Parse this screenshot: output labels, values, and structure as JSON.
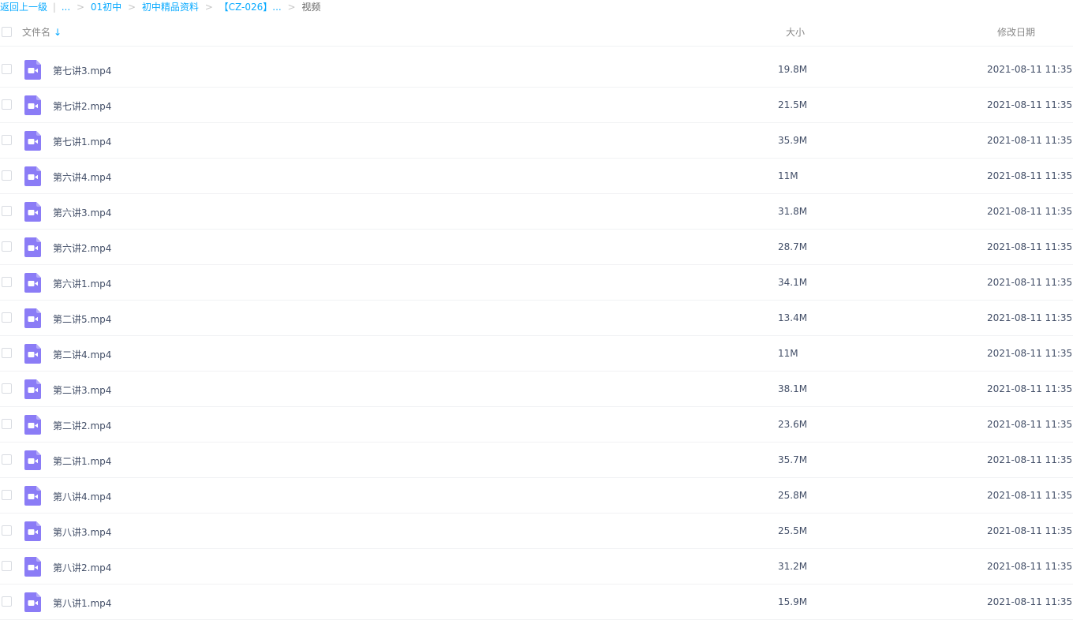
{
  "breadcrumb": {
    "back": "返回上一级",
    "divider": "|",
    "ellipsis1": "...",
    "crumb1": "01初中",
    "crumb2": "初中精品资料",
    "crumb3": "【CZ-026】...",
    "current": "视频",
    "sep": ">"
  },
  "header": {
    "name": "文件名",
    "sort_icon": "arrow-down-icon",
    "size": "大小",
    "date": "修改日期"
  },
  "accent_color": "#09aaff",
  "icon_color": "#8b7cf6",
  "files": [
    {
      "name": "第七讲3.mp4",
      "size": "19.8M",
      "date": "2021-08-11 11:35"
    },
    {
      "name": "第七讲2.mp4",
      "size": "21.5M",
      "date": "2021-08-11 11:35"
    },
    {
      "name": "第七讲1.mp4",
      "size": "35.9M",
      "date": "2021-08-11 11:35"
    },
    {
      "name": "第六讲4.mp4",
      "size": "11M",
      "date": "2021-08-11 11:35"
    },
    {
      "name": "第六讲3.mp4",
      "size": "31.8M",
      "date": "2021-08-11 11:35"
    },
    {
      "name": "第六讲2.mp4",
      "size": "28.7M",
      "date": "2021-08-11 11:35"
    },
    {
      "name": "第六讲1.mp4",
      "size": "34.1M",
      "date": "2021-08-11 11:35"
    },
    {
      "name": "第二讲5.mp4",
      "size": "13.4M",
      "date": "2021-08-11 11:35"
    },
    {
      "name": "第二讲4.mp4",
      "size": "11M",
      "date": "2021-08-11 11:35"
    },
    {
      "name": "第二讲3.mp4",
      "size": "38.1M",
      "date": "2021-08-11 11:35"
    },
    {
      "name": "第二讲2.mp4",
      "size": "23.6M",
      "date": "2021-08-11 11:35"
    },
    {
      "name": "第二讲1.mp4",
      "size": "35.7M",
      "date": "2021-08-11 11:35"
    },
    {
      "name": "第八讲4.mp4",
      "size": "25.8M",
      "date": "2021-08-11 11:35"
    },
    {
      "name": "第八讲3.mp4",
      "size": "25.5M",
      "date": "2021-08-11 11:35"
    },
    {
      "name": "第八讲2.mp4",
      "size": "31.2M",
      "date": "2021-08-11 11:35"
    },
    {
      "name": "第八讲1.mp4",
      "size": "15.9M",
      "date": "2021-08-11 11:35"
    }
  ]
}
